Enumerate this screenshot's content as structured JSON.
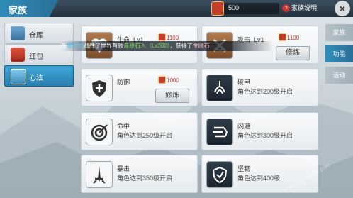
{
  "header": {
    "title": "家族",
    "currency_value": "500",
    "help_label": "家族说明",
    "close_label": "×"
  },
  "sidebar": {
    "items": [
      {
        "label": "仓库",
        "icon": "warehouse-icon",
        "active": false
      },
      {
        "label": "红包",
        "icon": "red-packet-icon",
        "active": false
      },
      {
        "label": "心法",
        "icon": "manual-icon",
        "active": true
      }
    ]
  },
  "right_tabs": [
    {
      "label": "家族",
      "active": false
    },
    {
      "label": "功能",
      "active": true
    },
    {
      "label": "活动",
      "active": false
    }
  ],
  "skills": [
    {
      "name": "生命",
      "level": "Lv1",
      "cost": "1100",
      "button": "",
      "requirement": "",
      "icon": "heart-icon"
    },
    {
      "name": "攻击",
      "level": "Lv1",
      "cost": "1100",
      "button": "修炼",
      "requirement": "",
      "icon": "crossed-swords-icon"
    },
    {
      "name": "防御",
      "level": "",
      "cost": "1000",
      "button": "修炼",
      "requirement": "",
      "icon": "shield-icon"
    },
    {
      "name": "破甲",
      "level": "",
      "cost": "",
      "button": "",
      "requirement": "角色达到200级开启",
      "icon": "armor-break-icon"
    },
    {
      "name": "命中",
      "level": "",
      "cost": "",
      "button": "",
      "requirement": "角色达到250级开启",
      "icon": "target-icon"
    },
    {
      "name": "闪避",
      "level": "",
      "cost": "",
      "button": "",
      "requirement": "角色达到300级开启",
      "icon": "dodge-icon"
    },
    {
      "name": "暴击",
      "level": "",
      "cost": "",
      "button": "",
      "requirement": "角色达到350级开启",
      "icon": "critical-sword-icon"
    },
    {
      "name": "坚韧",
      "level": "",
      "cost": "",
      "button": "",
      "requirement": "角色达到400级",
      "icon": "tenacity-icon"
    }
  ],
  "notice": {
    "prefix": "在",
    "player": "暖时光",
    "middle": "战胜了世界首领",
    "boss": "青原石人（Lv200）",
    "suffix": "，获得了",
    "reward": "金刚石"
  },
  "watermark": "www.hackhome.com"
}
